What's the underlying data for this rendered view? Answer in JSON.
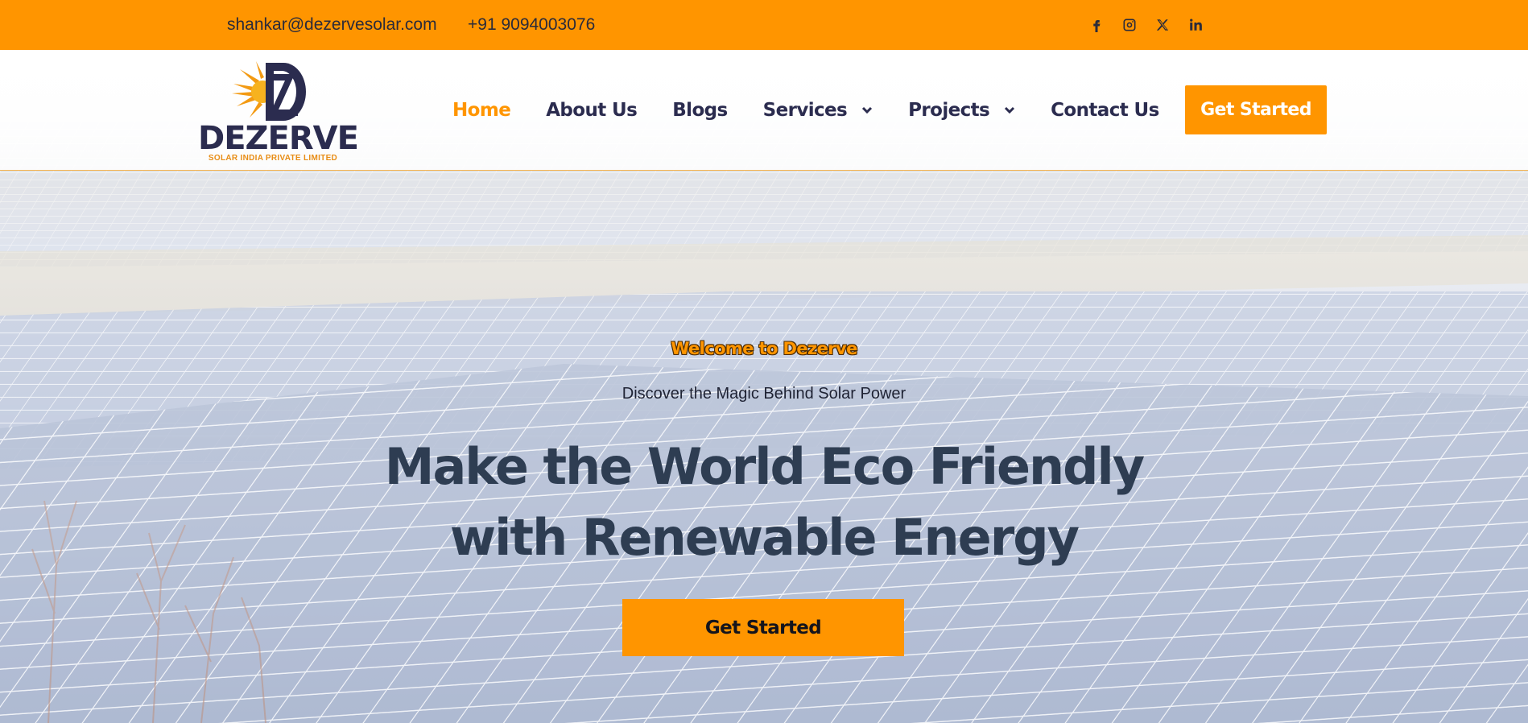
{
  "topbar": {
    "email": "shankar@dezervesolar.com",
    "phone": "+91 9094003076",
    "social": [
      {
        "icon": "facebook-icon"
      },
      {
        "icon": "instagram-icon"
      },
      {
        "icon": "x-twitter-icon"
      },
      {
        "icon": "linkedin-icon"
      }
    ]
  },
  "logo": {
    "wordmark": "DEZERVE",
    "tagline": "SOLAR INDIA PRIVATE LIMITED"
  },
  "nav": {
    "items": [
      {
        "label": "Home",
        "active": true
      },
      {
        "label": "About Us"
      },
      {
        "label": "Blogs"
      },
      {
        "label": "Services",
        "dropdown": true
      },
      {
        "label": "Projects",
        "dropdown": true
      },
      {
        "label": "Contact Us"
      }
    ],
    "cta": "Get Started"
  },
  "hero": {
    "welcome": "Welcome to Dezerve",
    "subtitle": "Discover the Magic Behind Solar Power",
    "headline_line1": "Make the World Eco Friendly",
    "headline_line2": "with Renewable Energy",
    "cta": "Get Started"
  },
  "colors": {
    "accent": "#ff9500",
    "dark": "#2b2c4f",
    "headline": "#2e3d52"
  }
}
